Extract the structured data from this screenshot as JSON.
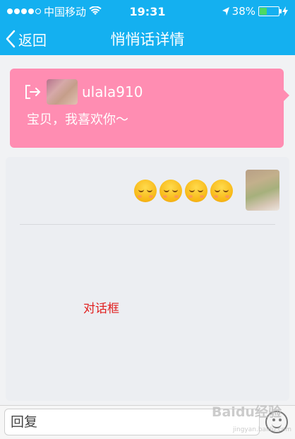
{
  "status_bar": {
    "carrier": "中国移动",
    "time": "19:31",
    "battery_percent": "38%",
    "battery_level": 0.38,
    "signal_dots_filled": 4,
    "signal_dots_total": 5,
    "icons": [
      "wifi-icon",
      "location-icon",
      "charging-icon"
    ]
  },
  "nav": {
    "back_label": "返回",
    "title": "悄悄话详情",
    "accent_color": "#14b0f0"
  },
  "message_card": {
    "sender_name": "ulala910",
    "message": "宝贝，我喜欢你～",
    "icons": [
      "sign-out-icon"
    ],
    "bg_color": "#ff8db2"
  },
  "conversation": {
    "emoji_count": 4,
    "emoji_icon": "smiley-emoji-icon",
    "annotation": "对话框",
    "annotation_color": "#e12020"
  },
  "reply": {
    "placeholder": "回复",
    "icons": [
      "emoji-button-icon"
    ]
  },
  "watermark": {
    "text": "Baidu经验",
    "url": "jingyan.baidu.com"
  }
}
